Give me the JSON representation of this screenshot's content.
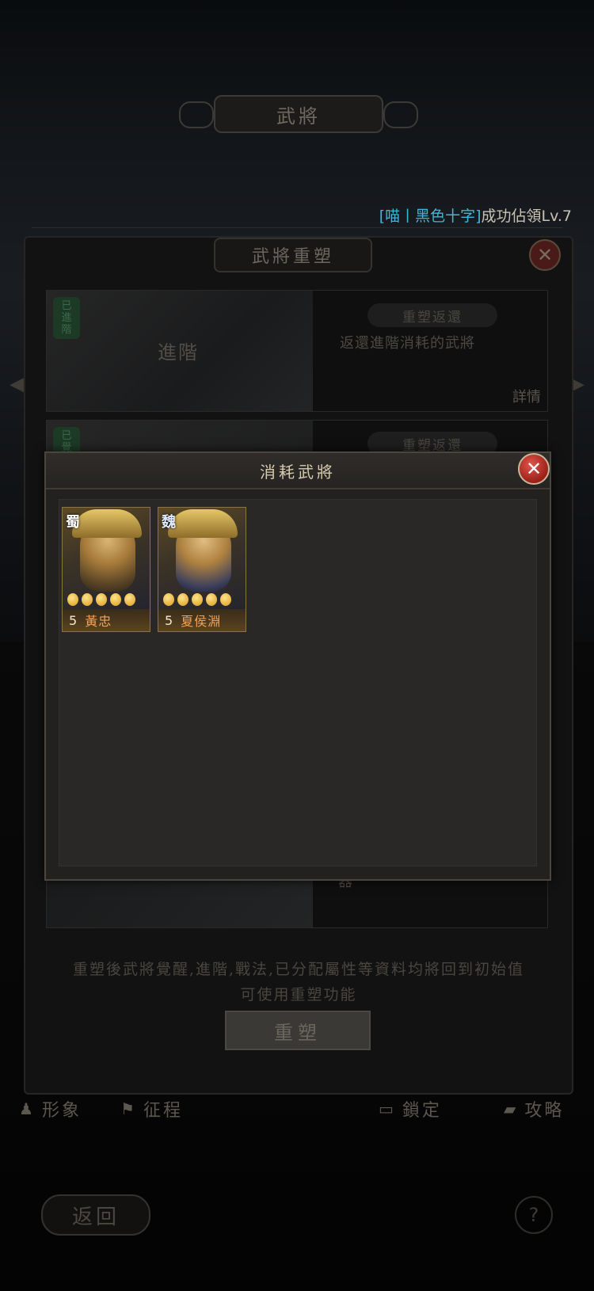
{
  "screen": {
    "top_title": "武將",
    "broadcast": {
      "name": "[喵丨黑色十字]",
      "suffix": "成功佔領Lv.7"
    }
  },
  "panel": {
    "title": "武將重塑",
    "close_icon": "x",
    "cards": [
      {
        "badge": "已進階",
        "art_label": "進階",
        "pill": "重塑返還",
        "description": "返還進階消耗的武將",
        "detail": "詳情"
      },
      {
        "badge": "已覺",
        "pill": "重塑返還"
      }
    ],
    "partial_text": "器",
    "note_line1": "重塑後武將覺醒,進階,戰法,已分配屬性等資料均將回到初始值",
    "note_line2": "可使用重塑功能",
    "button": "重塑"
  },
  "nav": {
    "image": "形象",
    "journey": "征程",
    "lock": "鎖定",
    "guide": "攻略"
  },
  "footer": {
    "back": "返回",
    "help": "?"
  },
  "modal": {
    "title": "消耗武將",
    "close_icon": "x",
    "heroes": [
      {
        "faction": "蜀",
        "level": "5",
        "name": "黃忠",
        "stars": 5
      },
      {
        "faction": "魏",
        "level": "5",
        "name": "夏侯淵",
        "stars": 5
      }
    ]
  }
}
